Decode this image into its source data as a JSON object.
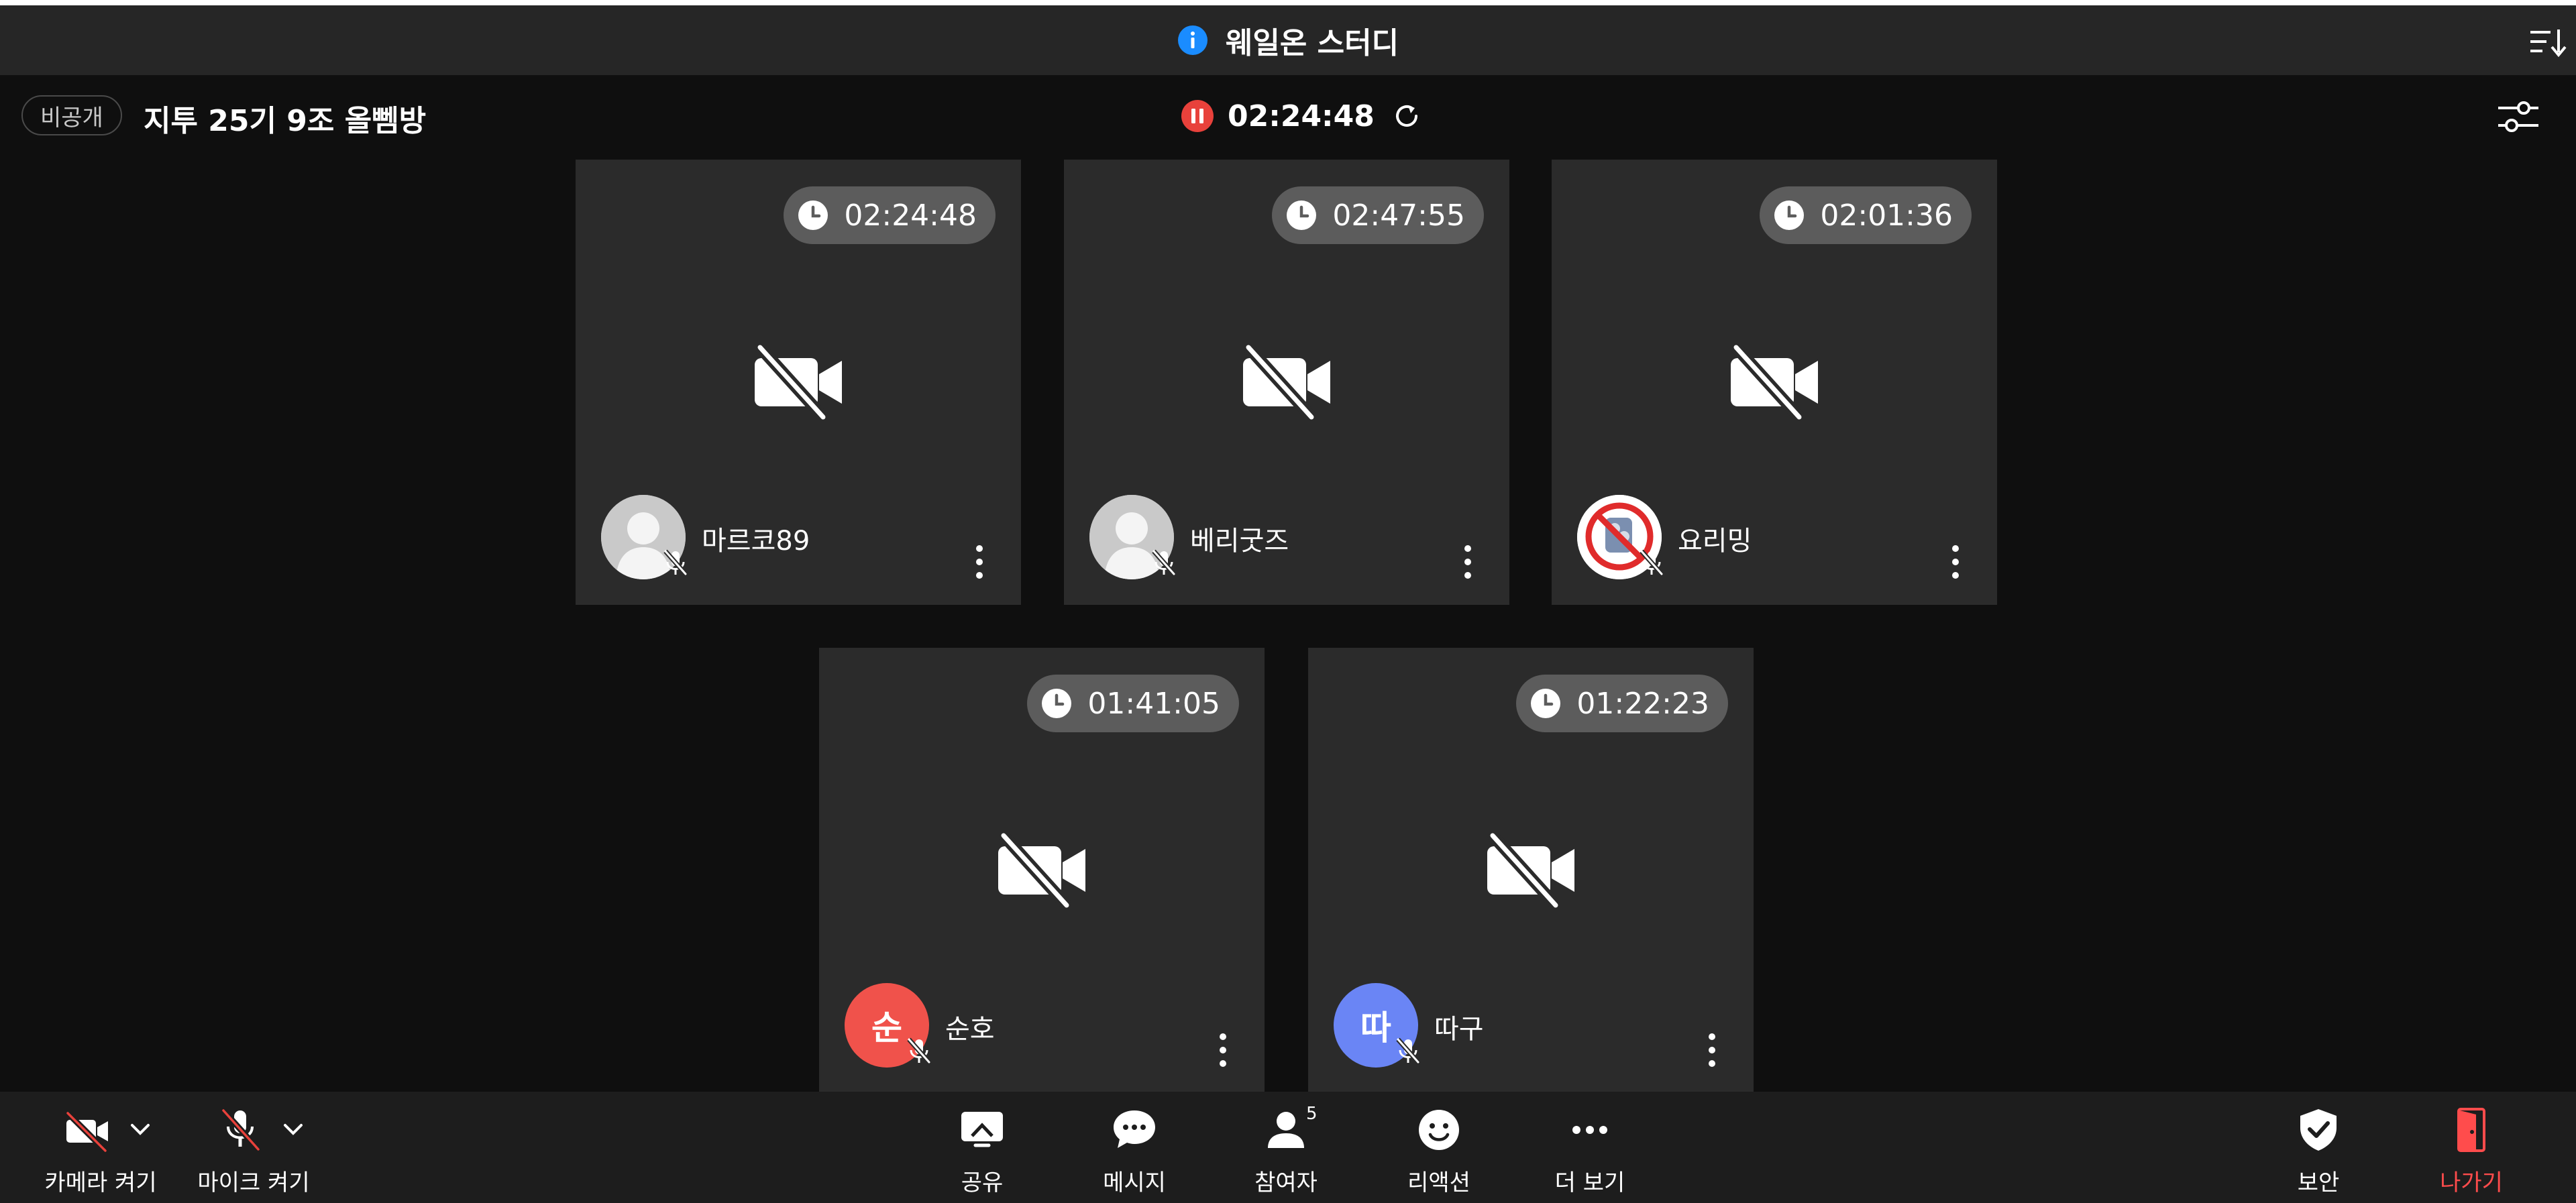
{
  "window": {
    "title": "웨일온 스터디"
  },
  "room": {
    "visibility": "비공개",
    "title": "지투 25기 9조 올뻼방",
    "elapsed": "02:24:48"
  },
  "participants": [
    {
      "name": "마르코89",
      "study_time": "02:24:48",
      "avatar_type": "default"
    },
    {
      "name": "베리굿즈",
      "study_time": "02:47:55",
      "avatar_type": "default"
    },
    {
      "name": "요리밍",
      "study_time": "02:01:36",
      "avatar_type": "photo"
    },
    {
      "name": "순호",
      "study_time": "01:41:05",
      "avatar_type": "initial",
      "initial": "순",
      "color": "#f0524b"
    },
    {
      "name": "따구",
      "study_time": "01:22:23",
      "avatar_type": "initial",
      "initial": "따",
      "color": "#6a85f5"
    }
  ],
  "toolbar": {
    "camera_label": "카메라 켜기",
    "mic_label": "마이크 켜기",
    "share_label": "공유",
    "message_label": "메시지",
    "participants_label": "참여자",
    "participants_count": "5",
    "reaction_label": "리액션",
    "more_label": "더 보기",
    "security_label": "보안",
    "exit_label": "나가기"
  },
  "colors": {
    "accent_blue": "#1a8cff",
    "record_red": "#e8413b",
    "exit_red": "#ff4c4c",
    "tile_bg": "#2b2b2b",
    "page_bg": "#0f0f0f"
  },
  "icons": {
    "title": "info-icon",
    "sort": "sort-icon",
    "timer": "pause-icon",
    "refresh": "refresh-icon",
    "settings": "settings-icon",
    "tile_clock": "clock-icon",
    "tile_camera": "camera-off-icon",
    "tile_mic": "mic-off-icon",
    "tile_menu": "kebab-icon"
  }
}
